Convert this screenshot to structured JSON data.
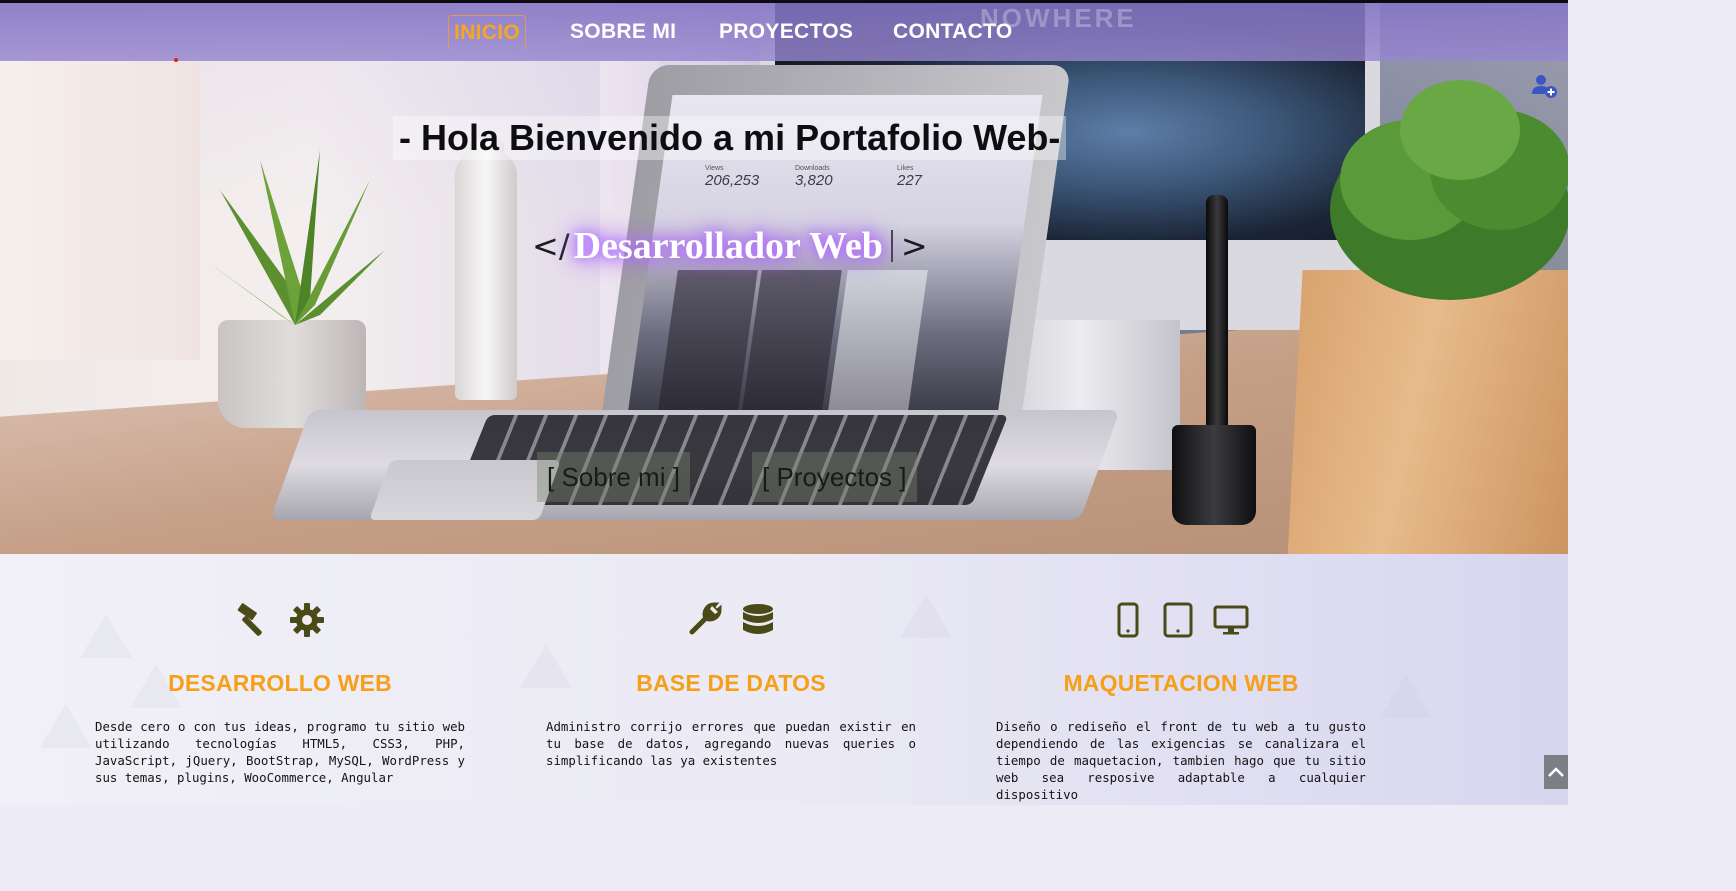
{
  "nav": {
    "items": [
      {
        "label": "INICIO",
        "active": true
      },
      {
        "label": "SOBRE MI",
        "active": false
      },
      {
        "label": "PROYECTOS",
        "active": false
      },
      {
        "label": "CONTACTO",
        "active": false
      }
    ],
    "accent_color": "#f5a623",
    "background_color": "#8a78c8"
  },
  "hero": {
    "welcome_text": "- Hola Bienvenido a mi Portafolio Web-",
    "role_open": "</",
    "role_text": "Desarrollador Web",
    "role_close": ">",
    "buttons": {
      "about": "[ Sobre mi ]",
      "projects": "[ Proyectos ]"
    },
    "laptop_stats": [
      {
        "label": "Views",
        "value": "206,253"
      },
      {
        "label": "Downloads",
        "value": "3,820"
      },
      {
        "label": "Likes",
        "value": "227"
      }
    ],
    "monitor_text": "NOWHERE",
    "icons": {
      "user_add": "user-plus-icon"
    }
  },
  "services": [
    {
      "title": "DESARROLLO WEB",
      "icons": [
        "hammer-icon",
        "gear-icon"
      ],
      "description": "Desde cero o con tus ideas, programo tu sitio web utilizando tecnologías HTML5, CSS3, PHP, JavaScript, jQuery, BootStrap, MySQL, WordPress y sus temas, plugins, WooCommerce, Angular"
    },
    {
      "title": "BASE DE DATOS",
      "icons": [
        "wrench-icon",
        "database-icon"
      ],
      "description": "Administro corrijo errores que puedan existir en tu base de datos, agregando nuevas queries o simplificando las ya existentes"
    },
    {
      "title": "MAQUETACION WEB",
      "icons": [
        "mobile-icon",
        "tablet-icon",
        "desktop-icon"
      ],
      "description": "Diseño o rediseño el front de tu web a tu gusto dependiendo de las exigencias se canalizara el tiempo de maquetacion, tambien hago que tu sitio web sea resposive adaptable a cualquier dispositivo"
    }
  ],
  "colors": {
    "service_title": "#f6a01a",
    "service_icon": "#4a4a18",
    "role_glow": "#a45cff"
  },
  "scroll_top_icon": "chevron-up-icon"
}
